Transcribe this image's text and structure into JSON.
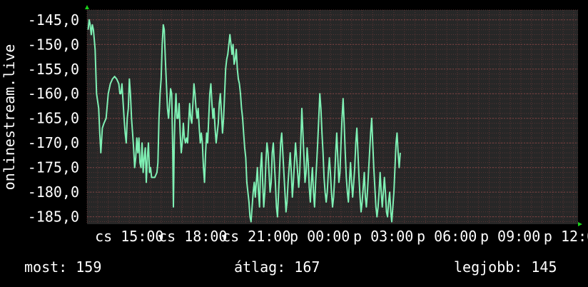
{
  "colors": {
    "background": "#000000",
    "plot_bg": "#272727",
    "grid": "#5a3535",
    "line": "#7ff0b4",
    "axis_arrow": "#1bd21b",
    "text": "#ffffff"
  },
  "stats": {
    "now_label": "most:",
    "now_value": "159",
    "avg_label": "átlag:",
    "avg_value": "167",
    "best_label": "legjobb:",
    "best_value": "145"
  },
  "chart_data": {
    "type": "line",
    "ylabel": "onlinestream.live",
    "ylim": [
      -186.5,
      -143
    ],
    "yticks": [
      {
        "value": -145,
        "label": "-145,0"
      },
      {
        "value": -150,
        "label": "-150,0"
      },
      {
        "value": -155,
        "label": "-155,0"
      },
      {
        "value": -160,
        "label": "-160,0"
      },
      {
        "value": -165,
        "label": "-165,0"
      },
      {
        "value": -170,
        "label": "-170,0"
      },
      {
        "value": -175,
        "label": "-175,0"
      },
      {
        "value": -180,
        "label": "-180,0"
      },
      {
        "value": -185,
        "label": "-185,0"
      }
    ],
    "xlim": [
      13.0,
      36.2
    ],
    "xticks": [
      {
        "value": 15,
        "label": "cs 15:00"
      },
      {
        "value": 18,
        "label": "cs 18:00"
      },
      {
        "value": 21,
        "label": "cs 21:00"
      },
      {
        "value": 24,
        "label": "p 00:00"
      },
      {
        "value": 27,
        "label": "p 03:00"
      },
      {
        "value": 30,
        "label": "p 06:00"
      },
      {
        "value": 33,
        "label": "p 09:00"
      },
      {
        "value": 36,
        "label": "p 12:00"
      }
    ],
    "grid": true,
    "series": [
      {
        "values": [
          [
            13.05,
            -147
          ],
          [
            13.1,
            -145
          ],
          [
            13.15,
            -146
          ],
          [
            13.2,
            -148
          ],
          [
            13.25,
            -146
          ],
          [
            13.3,
            -147
          ],
          [
            13.38,
            -151
          ],
          [
            13.45,
            -160
          ],
          [
            13.55,
            -163
          ],
          [
            13.6,
            -168
          ],
          [
            13.65,
            -172
          ],
          [
            13.72,
            -167
          ],
          [
            13.8,
            -166
          ],
          [
            13.9,
            -165
          ],
          [
            14.0,
            -160
          ],
          [
            14.1,
            -158
          ],
          [
            14.2,
            -157
          ],
          [
            14.3,
            -156.5
          ],
          [
            14.4,
            -157
          ],
          [
            14.5,
            -158
          ],
          [
            14.55,
            -160
          ],
          [
            14.6,
            -160
          ],
          [
            14.65,
            -158
          ],
          [
            14.75,
            -165
          ],
          [
            14.8,
            -168
          ],
          [
            14.85,
            -170
          ],
          [
            14.9,
            -165
          ],
          [
            14.95,
            -163
          ],
          [
            15.0,
            -157
          ],
          [
            15.05,
            -160
          ],
          [
            15.1,
            -165
          ],
          [
            15.15,
            -168
          ],
          [
            15.2,
            -171
          ],
          [
            15.25,
            -175
          ],
          [
            15.3,
            -173
          ],
          [
            15.35,
            -169
          ],
          [
            15.4,
            -172
          ],
          [
            15.45,
            -169
          ],
          [
            15.5,
            -174
          ],
          [
            15.55,
            -175
          ],
          [
            15.6,
            -170
          ],
          [
            15.65,
            -176
          ],
          [
            15.7,
            -173
          ],
          [
            15.75,
            -171
          ],
          [
            15.8,
            -178
          ],
          [
            15.85,
            -173
          ],
          [
            15.9,
            -170
          ],
          [
            15.95,
            -176
          ],
          [
            16.0,
            -175
          ],
          [
            16.05,
            -177
          ],
          [
            16.1,
            -177
          ],
          [
            16.2,
            -177
          ],
          [
            16.3,
            -176
          ],
          [
            16.35,
            -174
          ],
          [
            16.4,
            -165
          ],
          [
            16.45,
            -160
          ],
          [
            16.5,
            -157
          ],
          [
            16.55,
            -150
          ],
          [
            16.6,
            -146
          ],
          [
            16.65,
            -147
          ],
          [
            16.7,
            -153
          ],
          [
            16.75,
            -158
          ],
          [
            16.8,
            -163
          ],
          [
            16.85,
            -165
          ],
          [
            16.9,
            -162
          ],
          [
            16.95,
            -159
          ],
          [
            17.0,
            -160
          ],
          [
            17.05,
            -172
          ],
          [
            17.08,
            -183
          ],
          [
            17.12,
            -170
          ],
          [
            17.15,
            -165
          ],
          [
            17.2,
            -160
          ],
          [
            17.25,
            -165
          ],
          [
            17.3,
            -165
          ],
          [
            17.35,
            -162
          ],
          [
            17.4,
            -168
          ],
          [
            17.45,
            -172
          ],
          [
            17.5,
            -170
          ],
          [
            17.55,
            -166
          ],
          [
            17.6,
            -169
          ],
          [
            17.65,
            -170
          ],
          [
            17.7,
            -169
          ],
          [
            17.75,
            -170
          ],
          [
            17.8,
            -166
          ],
          [
            17.85,
            -162
          ],
          [
            17.9,
            -165
          ],
          [
            17.95,
            -166
          ],
          [
            18.0,
            -162
          ],
          [
            18.05,
            -158
          ],
          [
            18.1,
            -160
          ],
          [
            18.15,
            -163
          ],
          [
            18.2,
            -165
          ],
          [
            18.25,
            -163
          ],
          [
            18.3,
            -167
          ],
          [
            18.35,
            -170
          ],
          [
            18.4,
            -168
          ],
          [
            18.45,
            -170
          ],
          [
            18.5,
            -175
          ],
          [
            18.55,
            -178
          ],
          [
            18.6,
            -172
          ],
          [
            18.65,
            -168
          ],
          [
            18.7,
            -170
          ],
          [
            18.75,
            -165
          ],
          [
            18.8,
            -160
          ],
          [
            18.85,
            -158
          ],
          [
            18.9,
            -162
          ],
          [
            18.95,
            -165
          ],
          [
            19.0,
            -163
          ],
          [
            19.05,
            -167
          ],
          [
            19.1,
            -170
          ],
          [
            19.15,
            -168
          ],
          [
            19.2,
            -166
          ],
          [
            19.25,
            -162
          ],
          [
            19.3,
            -160
          ],
          [
            19.35,
            -164
          ],
          [
            19.4,
            -168
          ],
          [
            19.45,
            -165
          ],
          [
            19.5,
            -160
          ],
          [
            19.55,
            -155
          ],
          [
            19.6,
            -153
          ],
          [
            19.65,
            -152
          ],
          [
            19.7,
            -150
          ],
          [
            19.75,
            -148
          ],
          [
            19.8,
            -150
          ],
          [
            19.85,
            -152
          ],
          [
            19.9,
            -150
          ],
          [
            19.95,
            -154
          ],
          [
            20.0,
            -153
          ],
          [
            20.05,
            -151
          ],
          [
            20.1,
            -155
          ],
          [
            20.15,
            -157
          ],
          [
            20.2,
            -158
          ],
          [
            20.25,
            -160
          ],
          [
            20.3,
            -163
          ],
          [
            20.35,
            -165
          ],
          [
            20.4,
            -168
          ],
          [
            20.45,
            -171
          ],
          [
            20.5,
            -173
          ],
          [
            20.55,
            -178
          ],
          [
            20.6,
            -180
          ],
          [
            20.65,
            -182
          ],
          [
            20.7,
            -185
          ],
          [
            20.75,
            -186
          ],
          [
            20.8,
            -183
          ],
          [
            20.85,
            -180
          ],
          [
            20.9,
            -178
          ],
          [
            20.95,
            -181
          ],
          [
            21.0,
            -178
          ],
          [
            21.05,
            -175
          ],
          [
            21.1,
            -180
          ],
          [
            21.15,
            -183
          ],
          [
            21.2,
            -175
          ],
          [
            21.25,
            -172
          ],
          [
            21.3,
            -178
          ],
          [
            21.35,
            -183
          ],
          [
            21.4,
            -180
          ],
          [
            21.45,
            -174
          ],
          [
            21.5,
            -170
          ],
          [
            21.55,
            -172
          ],
          [
            21.6,
            -176
          ],
          [
            21.65,
            -180
          ],
          [
            21.7,
            -178
          ],
          [
            21.75,
            -172
          ],
          [
            21.8,
            -170
          ],
          [
            21.85,
            -174
          ],
          [
            21.9,
            -178
          ],
          [
            21.95,
            -183
          ],
          [
            22.0,
            -185
          ],
          [
            22.05,
            -180
          ],
          [
            22.1,
            -175
          ],
          [
            22.15,
            -170
          ],
          [
            22.2,
            -168
          ],
          [
            22.25,
            -172
          ],
          [
            22.3,
            -176
          ],
          [
            22.35,
            -180
          ],
          [
            22.4,
            -184
          ],
          [
            22.45,
            -182
          ],
          [
            22.5,
            -178
          ],
          [
            22.55,
            -175
          ],
          [
            22.6,
            -172
          ],
          [
            22.65,
            -176
          ],
          [
            22.7,
            -181
          ],
          [
            22.75,
            -178
          ],
          [
            22.8,
            -174
          ],
          [
            22.85,
            -170
          ],
          [
            22.9,
            -173
          ],
          [
            22.95,
            -176
          ],
          [
            23.0,
            -179
          ],
          [
            23.05,
            -176
          ],
          [
            23.1,
            -170
          ],
          [
            23.15,
            -163
          ],
          [
            23.2,
            -168
          ],
          [
            23.25,
            -173
          ],
          [
            23.3,
            -178
          ],
          [
            23.35,
            -176
          ],
          [
            23.4,
            -171
          ],
          [
            23.45,
            -174
          ],
          [
            23.5,
            -179
          ],
          [
            23.55,
            -182
          ],
          [
            23.6,
            -178
          ],
          [
            23.65,
            -175
          ],
          [
            23.7,
            -180
          ],
          [
            23.75,
            -183
          ],
          [
            23.8,
            -178
          ],
          [
            23.85,
            -174
          ],
          [
            23.9,
            -170
          ],
          [
            23.95,
            -165
          ],
          [
            24.0,
            -160
          ],
          [
            24.05,
            -163
          ],
          [
            24.1,
            -168
          ],
          [
            24.15,
            -172
          ],
          [
            24.2,
            -177
          ],
          [
            24.25,
            -180
          ],
          [
            24.3,
            -182
          ],
          [
            24.35,
            -180
          ],
          [
            24.4,
            -176
          ],
          [
            24.45,
            -173
          ],
          [
            24.5,
            -176
          ],
          [
            24.55,
            -180
          ],
          [
            24.6,
            -183
          ],
          [
            24.65,
            -181
          ],
          [
            24.7,
            -177
          ],
          [
            24.75,
            -172
          ],
          [
            24.8,
            -168
          ],
          [
            24.85,
            -173
          ],
          [
            24.9,
            -178
          ],
          [
            24.95,
            -176
          ],
          [
            25.0,
            -170
          ],
          [
            25.05,
            -165
          ],
          [
            25.1,
            -161
          ],
          [
            25.15,
            -166
          ],
          [
            25.2,
            -172
          ],
          [
            25.25,
            -177
          ],
          [
            25.3,
            -180
          ],
          [
            25.35,
            -182
          ],
          [
            25.4,
            -178
          ],
          [
            25.45,
            -174
          ],
          [
            25.5,
            -178
          ],
          [
            25.55,
            -181
          ],
          [
            25.6,
            -178
          ],
          [
            25.65,
            -175
          ],
          [
            25.7,
            -170
          ],
          [
            25.75,
            -167
          ],
          [
            25.8,
            -172
          ],
          [
            25.85,
            -177
          ],
          [
            25.9,
            -181
          ],
          [
            25.95,
            -184
          ],
          [
            26.0,
            -182
          ],
          [
            26.05,
            -179
          ],
          [
            26.1,
            -176
          ],
          [
            26.15,
            -181
          ],
          [
            26.2,
            -183
          ],
          [
            26.25,
            -180
          ],
          [
            26.3,
            -176
          ],
          [
            26.35,
            -172
          ],
          [
            26.4,
            -168
          ],
          [
            26.45,
            -165
          ],
          [
            26.5,
            -170
          ],
          [
            26.55,
            -175
          ],
          [
            26.6,
            -179
          ],
          [
            26.65,
            -183
          ],
          [
            26.7,
            -185
          ],
          [
            26.75,
            -183
          ],
          [
            26.8,
            -180
          ],
          [
            26.85,
            -176
          ],
          [
            26.9,
            -180
          ],
          [
            26.95,
            -183
          ],
          [
            27.0,
            -180
          ],
          [
            27.05,
            -177
          ],
          [
            27.1,
            -180
          ],
          [
            27.15,
            -184
          ],
          [
            27.2,
            -185
          ],
          [
            27.25,
            -182
          ],
          [
            27.3,
            -180
          ],
          [
            27.35,
            -184
          ],
          [
            27.4,
            -186
          ],
          [
            27.45,
            -183
          ],
          [
            27.5,
            -180
          ],
          [
            27.55,
            -175
          ],
          [
            27.6,
            -170
          ],
          [
            27.65,
            -168
          ],
          [
            27.7,
            -172
          ],
          [
            27.75,
            -175
          ],
          [
            27.8,
            -172
          ]
        ]
      }
    ]
  }
}
